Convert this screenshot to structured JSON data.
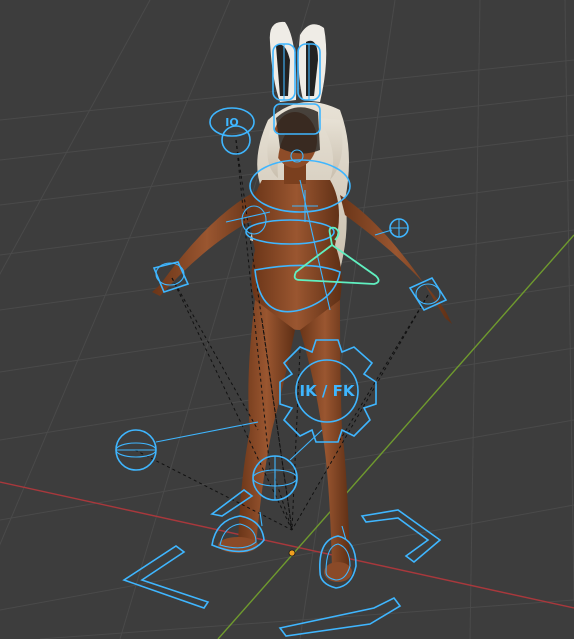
{
  "viewport": {
    "background": "#3d3d3d",
    "grid_color": "#4a4a4a",
    "x_axis_color": "#a8383c",
    "y_axis_color": "#6f9a2e",
    "rig_color": "#3fb6ff",
    "hanger_color": "#60f0c0",
    "origin_color": "#f0a020"
  },
  "ikfk_gear": {
    "label": "IK / FK"
  },
  "head_widget": {
    "label": "IO"
  }
}
